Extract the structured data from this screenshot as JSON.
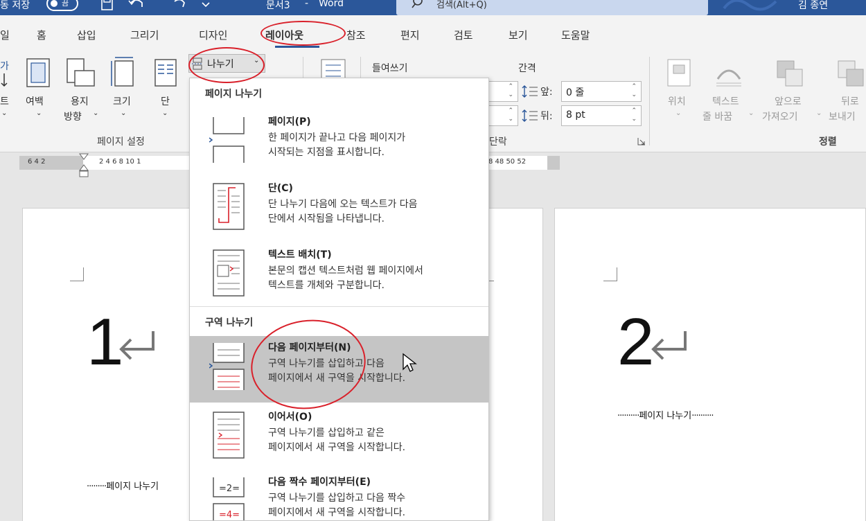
{
  "titlebar": {
    "autosave_label": "동 저장",
    "autosave_toggle": "끔",
    "document_title": "문서3",
    "app_name": "Word",
    "search_placeholder": "검색(Alt+Q)",
    "user_name": "김 종연",
    "bg_color": "#2b579a"
  },
  "tabs": [
    "일",
    "홈",
    "삽입",
    "그리기",
    "디자인",
    "레이아웃",
    "참조",
    "편지",
    "검토",
    "보기",
    "도움말"
  ],
  "active_tab": "레이아웃",
  "ribbon": {
    "page_setup": {
      "buttons": {
        "text_direction": "트",
        "margins": "여백",
        "orientation_1": "용지",
        "orientation_2": "방향",
        "size": "크기",
        "columns": "단",
        "breaks": "나누기"
      },
      "group_label": "페이지 설정"
    },
    "paragraph": {
      "indent_label": "들여쓰기",
      "spacing_label": "간격",
      "before_label": "앞:",
      "before_value": "0 줄",
      "after_label": "뒤:",
      "after_value": "8 pt",
      "group_label": "단락"
    },
    "arrange": {
      "position": "위치",
      "wrap_text_1": "텍스트",
      "wrap_text_2": "줄 바꿈",
      "bring_forward_1": "앞으로",
      "bring_forward_2": "가져오기",
      "send_backward_1": "뒤로",
      "send_backward_2": "보내기",
      "group_label": "정렬"
    }
  },
  "ruler": {
    "left_numbers": "6   4   2",
    "right_numbers": "2   4   6   8  10  1",
    "tail_numbers": "8  48  50  52"
  },
  "document": {
    "page1_number": "1",
    "page2_number": "2",
    "page_break_1": "페이지 나누기",
    "page_break_2": "페이지 나누기"
  },
  "breaks_menu": {
    "page_breaks_heading": "페이지 나누기",
    "section_breaks_heading": "구역 나누기",
    "items": [
      {
        "title": "페이지(P)",
        "desc1": "한 페이지가 끝나고 다음 페이지가",
        "desc2": "시작되는 지점을 표시합니다."
      },
      {
        "title": "단(C)",
        "desc1": "단 나누기 다음에 오는 텍스트가 다음",
        "desc2": "단에서 시작됨을 나타냅니다."
      },
      {
        "title": "텍스트 배치(T)",
        "desc1": "본문의 캡션 텍스트처럼 웹 페이지에서",
        "desc2": "텍스트를 개체와 구분합니다."
      },
      {
        "title": "다음 페이지부터(N)",
        "desc1": "구역 나누기를 삽입하고 다음",
        "desc2": "페이지에서 새 구역을 시작합니다."
      },
      {
        "title": "이어서(O)",
        "desc1": "구역 나누기를 삽입하고 같은",
        "desc2": "페이지에서 새 구역을 시작합니다."
      },
      {
        "title": "다음 짝수 페이지부터(E)",
        "desc1": "구역 나누기를 삽입하고 다음 짝수",
        "desc2": "페이지에서 새 구역을 시작합니다."
      }
    ],
    "highlighted_index": 3
  },
  "colors": {
    "accent": "#2b579a",
    "annotation_red": "#d9202a",
    "highlight": "#c5c5c5"
  }
}
